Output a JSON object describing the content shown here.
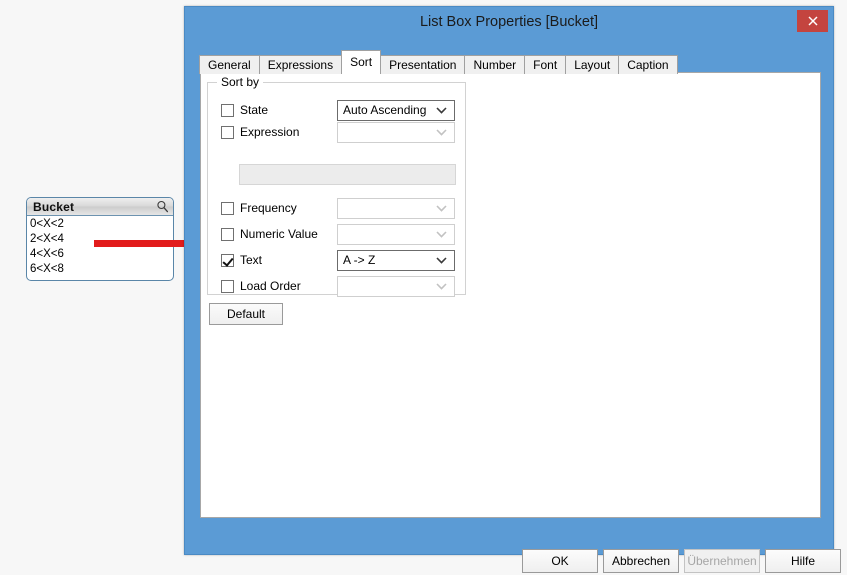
{
  "listbox": {
    "caption": "Bucket",
    "search_icon": "magnifier-icon",
    "items": [
      "0<X<2",
      "2<X<4",
      "4<X<6",
      "6<X<8"
    ]
  },
  "annotation": {
    "arrow_icon": "red-arrow-icon",
    "color": "#e21b1b"
  },
  "dialog": {
    "title": "List Box Properties [Bucket]",
    "close_icon": "close-icon",
    "titlebar_color": "#5b9bd5",
    "close_color": "#c4443f",
    "tabs": [
      {
        "label": "General",
        "active": false
      },
      {
        "label": "Expressions",
        "active": false
      },
      {
        "label": "Sort",
        "active": true
      },
      {
        "label": "Presentation",
        "active": false
      },
      {
        "label": "Number",
        "active": false
      },
      {
        "label": "Font",
        "active": false
      },
      {
        "label": "Layout",
        "active": false
      },
      {
        "label": "Caption",
        "active": false
      }
    ],
    "sort_group": {
      "legend": "Sort by",
      "rows": [
        {
          "label": "State",
          "checked": false,
          "combo_value": "Auto Ascending",
          "combo_enabled": true
        },
        {
          "label": "Expression",
          "checked": false,
          "combo_value": "",
          "combo_enabled": false
        },
        {
          "label": "Frequency",
          "checked": false,
          "combo_value": "",
          "combo_enabled": false
        },
        {
          "label": "Numeric Value",
          "checked": false,
          "combo_value": "",
          "combo_enabled": false
        },
        {
          "label": "Text",
          "checked": true,
          "combo_value": "A -> Z",
          "combo_enabled": true
        },
        {
          "label": "Load Order",
          "checked": false,
          "combo_value": "",
          "combo_enabled": false
        }
      ],
      "expression_value": ""
    },
    "default_button": "Default",
    "footer": {
      "ok": "OK",
      "cancel": "Abbrechen",
      "apply": "Übernehmen",
      "help": "Hilfe"
    }
  }
}
